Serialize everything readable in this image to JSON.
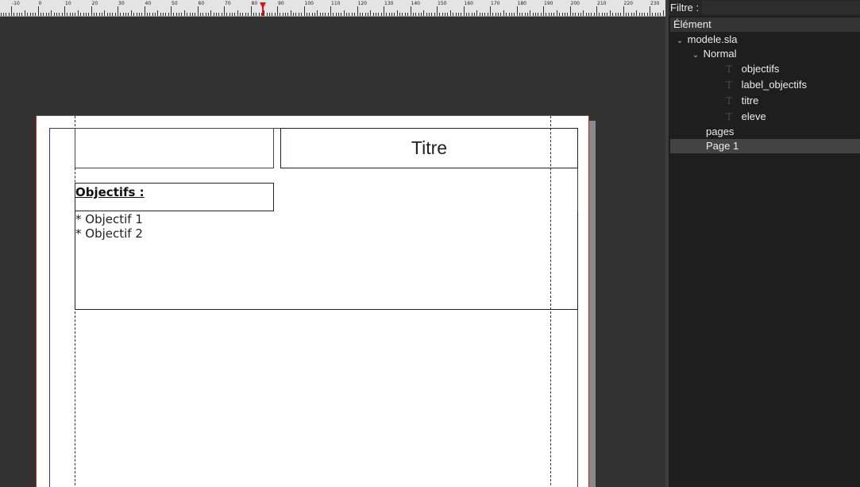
{
  "ruler": {
    "labels": [
      "-10",
      "0",
      "10",
      "20",
      "30",
      "40",
      "50",
      "60",
      "70",
      "80",
      "90",
      "100",
      "110",
      "120",
      "130",
      "140",
      "150",
      "160",
      "170",
      "180",
      "190",
      "200",
      "210",
      "220",
      "230"
    ]
  },
  "document": {
    "title_frame_text": "Titre",
    "label_text": "Objectifs :",
    "objectives": [
      "* Objectif 1",
      "* Objectif 2"
    ]
  },
  "panel": {
    "filter_label": "Filtre :",
    "filter_value": "",
    "tree_header": "Élément",
    "tree": {
      "root": "modele.sla",
      "normal": "Normal",
      "items": [
        "objectifs",
        "label_objectifs",
        "titre",
        "eleve"
      ],
      "pages": "pages",
      "page1": "Page 1"
    }
  },
  "colors": {
    "canvas_bg": "#323232",
    "page_border": "#e02020",
    "panel_bg": "#1e1e1e",
    "selection": "#434343"
  }
}
